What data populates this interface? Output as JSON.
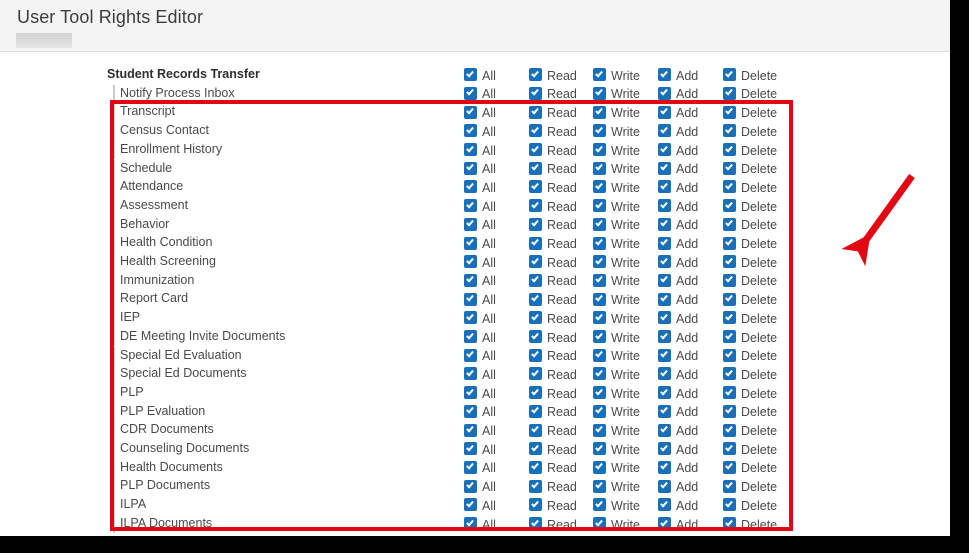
{
  "header": {
    "title": "User Tool Rights Editor",
    "redacted_placeholder": ""
  },
  "permissions": {
    "columns": [
      "All",
      "Read",
      "Write",
      "Add",
      "Delete"
    ]
  },
  "tree": {
    "rows": [
      {
        "label": "Student Records Transfer",
        "level": "parent",
        "checked": [
          true,
          true,
          true,
          true,
          true
        ]
      },
      {
        "label": "Notify Process Inbox",
        "level": "child",
        "checked": [
          true,
          true,
          true,
          true,
          true
        ]
      },
      {
        "label": "Transcript",
        "level": "child",
        "checked": [
          true,
          true,
          true,
          true,
          true
        ]
      },
      {
        "label": "Census Contact",
        "level": "child",
        "checked": [
          true,
          true,
          true,
          true,
          true
        ]
      },
      {
        "label": "Enrollment History",
        "level": "child",
        "checked": [
          true,
          true,
          true,
          true,
          true
        ]
      },
      {
        "label": "Schedule",
        "level": "child",
        "checked": [
          true,
          true,
          true,
          true,
          true
        ]
      },
      {
        "label": "Attendance",
        "level": "child",
        "checked": [
          true,
          true,
          true,
          true,
          true
        ]
      },
      {
        "label": "Assessment",
        "level": "child",
        "checked": [
          true,
          true,
          true,
          true,
          true
        ]
      },
      {
        "label": "Behavior",
        "level": "child",
        "checked": [
          true,
          true,
          true,
          true,
          true
        ]
      },
      {
        "label": "Health Condition",
        "level": "child",
        "checked": [
          true,
          true,
          true,
          true,
          true
        ]
      },
      {
        "label": "Health Screening",
        "level": "child",
        "checked": [
          true,
          true,
          true,
          true,
          true
        ]
      },
      {
        "label": "Immunization",
        "level": "child",
        "checked": [
          true,
          true,
          true,
          true,
          true
        ]
      },
      {
        "label": "Report Card",
        "level": "child",
        "checked": [
          true,
          true,
          true,
          true,
          true
        ]
      },
      {
        "label": "IEP",
        "level": "child",
        "checked": [
          true,
          true,
          true,
          true,
          true
        ]
      },
      {
        "label": "DE Meeting Invite Documents",
        "level": "child",
        "checked": [
          true,
          true,
          true,
          true,
          true
        ]
      },
      {
        "label": "Special Ed Evaluation",
        "level": "child",
        "checked": [
          true,
          true,
          true,
          true,
          true
        ]
      },
      {
        "label": "Special Ed Documents",
        "level": "child",
        "checked": [
          true,
          true,
          true,
          true,
          true
        ]
      },
      {
        "label": "PLP",
        "level": "child",
        "checked": [
          true,
          true,
          true,
          true,
          true
        ]
      },
      {
        "label": "PLP Evaluation",
        "level": "child",
        "checked": [
          true,
          true,
          true,
          true,
          true
        ]
      },
      {
        "label": "CDR Documents",
        "level": "child",
        "checked": [
          true,
          true,
          true,
          true,
          true
        ]
      },
      {
        "label": "Counseling Documents",
        "level": "child",
        "checked": [
          true,
          true,
          true,
          true,
          true
        ]
      },
      {
        "label": "Health Documents",
        "level": "child",
        "checked": [
          true,
          true,
          true,
          true,
          true
        ]
      },
      {
        "label": "PLP Documents",
        "level": "child",
        "checked": [
          true,
          true,
          true,
          true,
          true
        ]
      },
      {
        "label": "ILPA",
        "level": "child",
        "checked": [
          true,
          true,
          true,
          true,
          true
        ]
      },
      {
        "label": "ILPA Documents",
        "level": "child",
        "checked": [
          true,
          true,
          true,
          true,
          true
        ]
      }
    ]
  },
  "annotations": {
    "highlight_color": "#e30613",
    "arrow_color": "#e30613",
    "highlight_from_row": "Transcript",
    "highlight_to_row": "ILPA Documents"
  },
  "colors": {
    "checkbox_fill": "#1a70b8",
    "header_bg": "#f4f4f4",
    "text": "#4a4a4a"
  }
}
